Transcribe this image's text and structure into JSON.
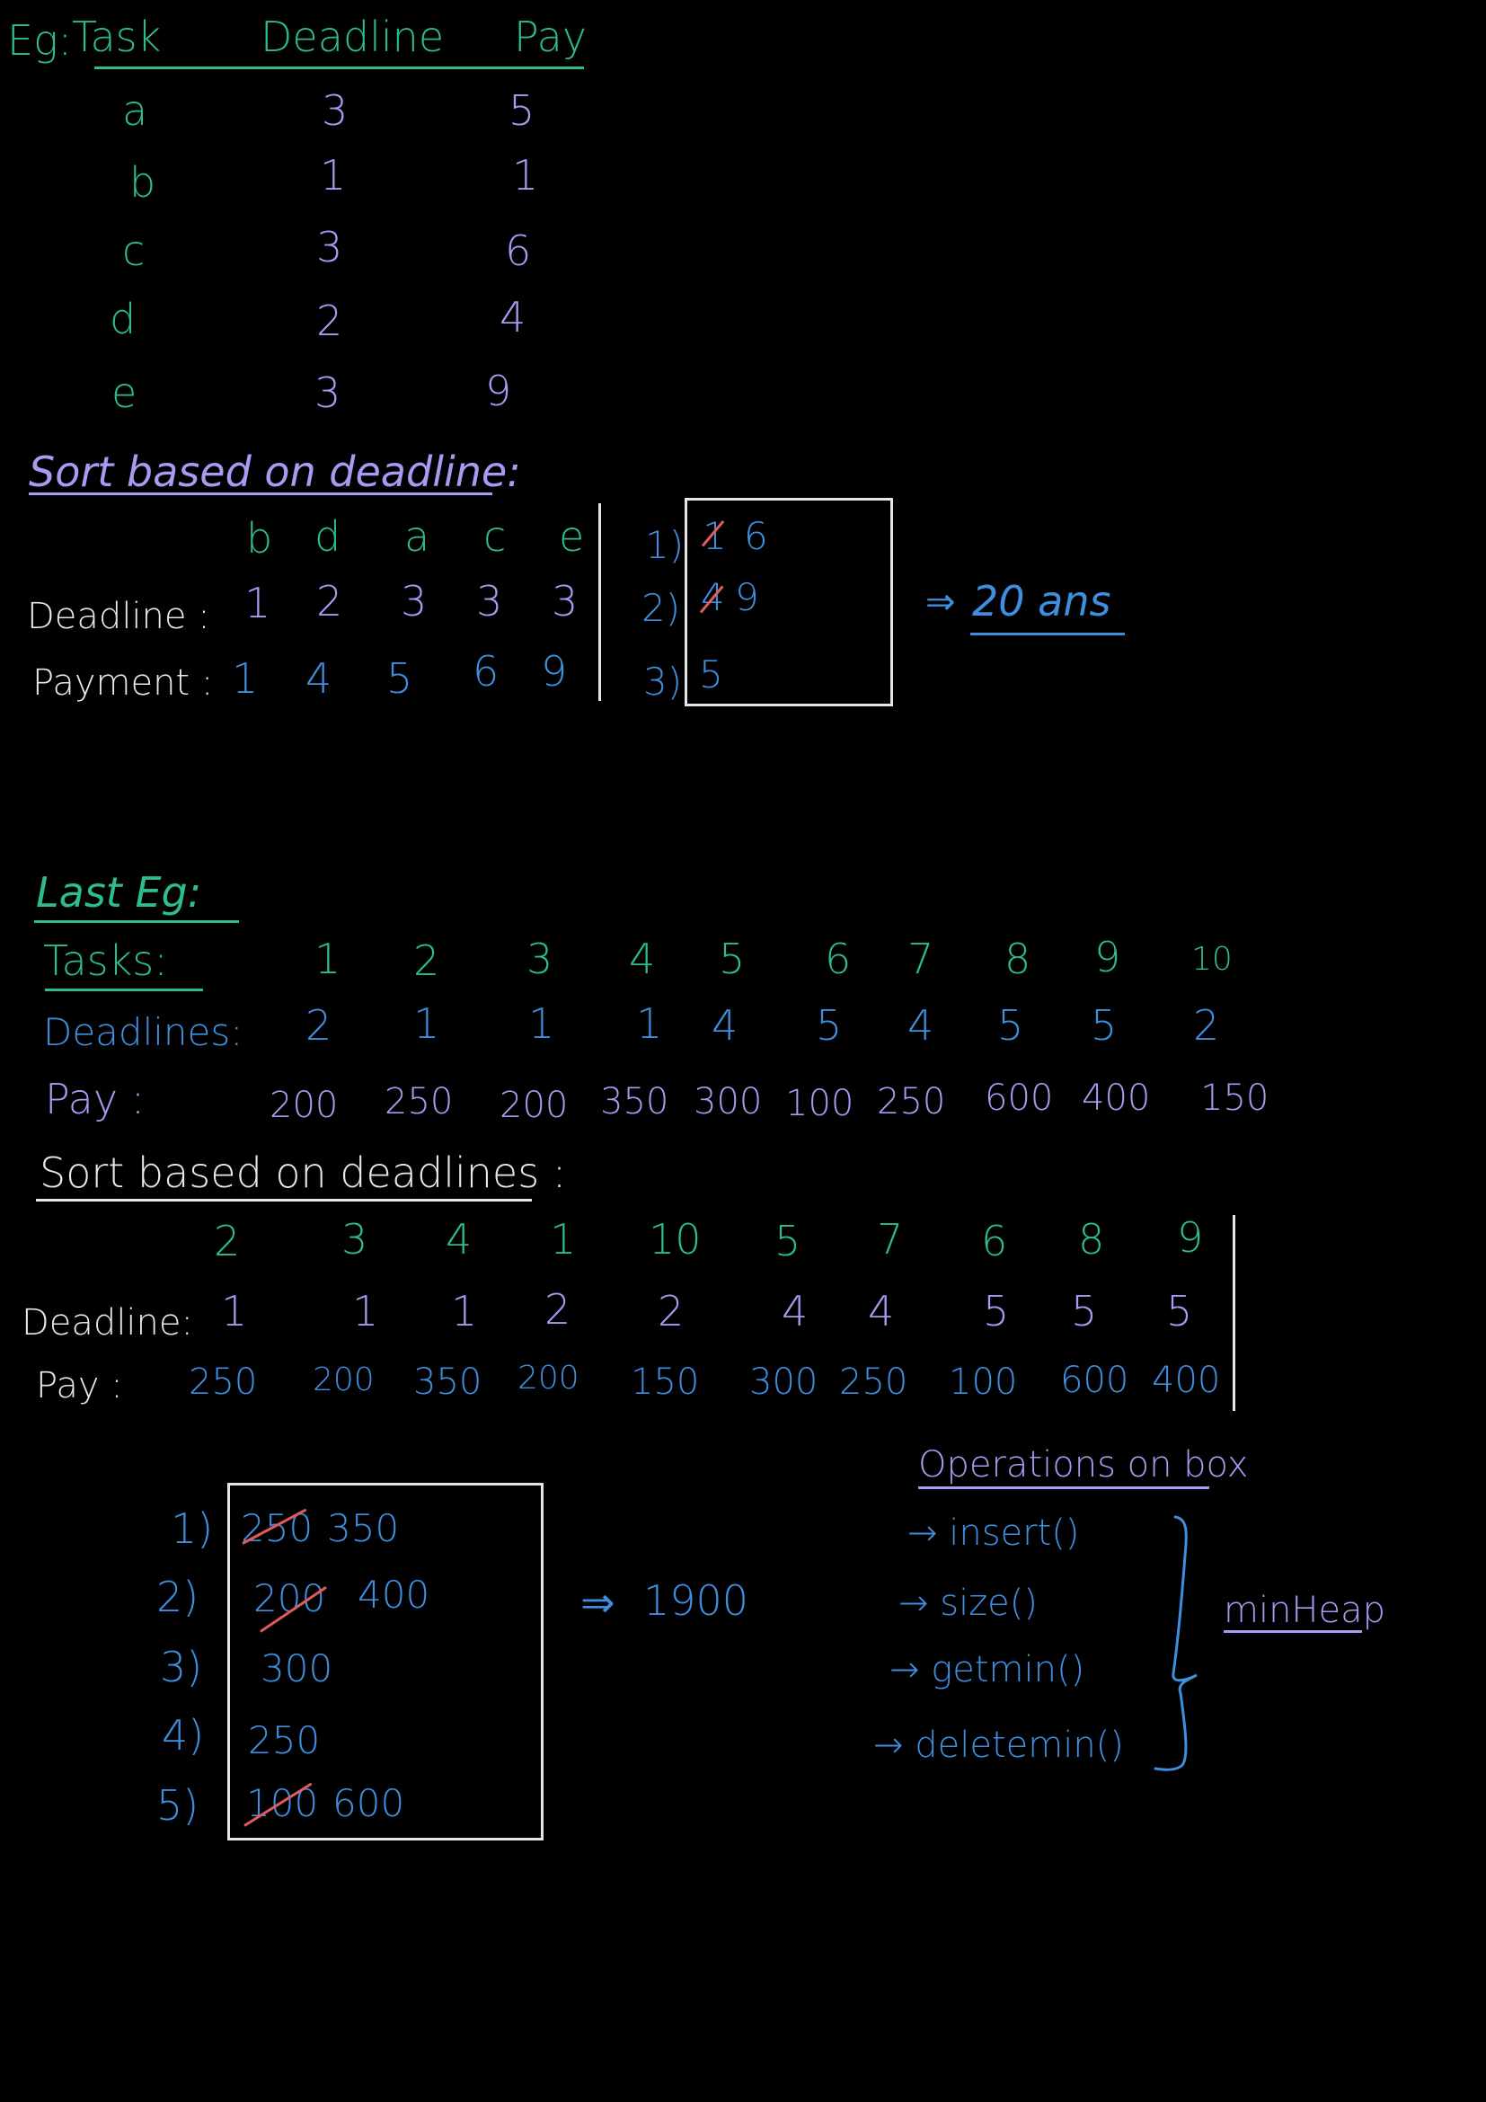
{
  "example1": {
    "label": "Eg:",
    "headers": [
      "Task",
      "Deadline",
      "Pay"
    ],
    "rows": [
      {
        "task": "a",
        "deadline": "3",
        "pay": "5"
      },
      {
        "task": "b",
        "deadline": "1",
        "pay": "1"
      },
      {
        "task": "c",
        "deadline": "3",
        "pay": "6"
      },
      {
        "task": "d",
        "deadline": "2",
        "pay": "4"
      },
      {
        "task": "e",
        "deadline": "3",
        "pay": "9"
      }
    ],
    "sort_heading": "Sort based on deadline:",
    "sorted_tasks": [
      "b",
      "d",
      "a",
      "c",
      "e"
    ],
    "deadline_label": "Deadline :",
    "sorted_deadlines": [
      "1",
      "2",
      "3",
      "3",
      "3"
    ],
    "payment_label": "Payment :",
    "sorted_payments": [
      "1",
      "4",
      "5",
      "6",
      "9"
    ],
    "slot_labels": [
      "1)",
      "2)",
      "3)"
    ],
    "slots": [
      {
        "struck": "1",
        "value": "6"
      },
      {
        "struck": "4",
        "value": "9"
      },
      {
        "struck": "",
        "value": "5"
      }
    ],
    "result_arrow": "⇒",
    "result": "20 ans"
  },
  "example2": {
    "heading": "Last Eg:",
    "tasks_label": "Tasks:",
    "tasks": [
      "1",
      "2",
      "3",
      "4",
      "5",
      "6",
      "7",
      "8",
      "9",
      "10"
    ],
    "deadlines_label": "Deadlines:",
    "deadlines": [
      "2",
      "1",
      "1",
      "1",
      "4",
      "5",
      "4",
      "5",
      "5",
      "2"
    ],
    "pay_label": "Pay :",
    "pays": [
      "200",
      "250",
      "200",
      "350",
      "300",
      "100",
      "250",
      "600",
      "400",
      "150"
    ],
    "sort_heading": "Sort based on deadlines :",
    "sorted_tasks": [
      "2",
      "3",
      "4",
      "1",
      "10",
      "5",
      "7",
      "6",
      "8",
      "9"
    ],
    "sorted_deadline_label": "Deadline:",
    "sorted_deadlines": [
      "1",
      "1",
      "1",
      "2",
      "2",
      "4",
      "4",
      "5",
      "5",
      "5"
    ],
    "sorted_pay_label": "Pay :",
    "sorted_pays": [
      "250",
      "200",
      "350",
      "200",
      "150",
      "300",
      "250",
      "100",
      "600",
      "400"
    ],
    "slot_labels": [
      "1)",
      "2)",
      "3)",
      "4)",
      "5)"
    ],
    "slots": [
      {
        "struck": "250",
        "value": "350"
      },
      {
        "struck": "200",
        "value": "400"
      },
      {
        "struck": "",
        "value": "300"
      },
      {
        "struck": "",
        "value": "250"
      },
      {
        "struck": "100",
        "value": "600"
      }
    ],
    "result_arrow": "⇒",
    "result": "1900",
    "operations_heading": "Operations on box",
    "operations": [
      "→ insert()",
      "→ size()",
      "→ getmin()",
      "→ deletemin()"
    ],
    "structure": "minHeap"
  },
  "colors": {
    "background": "#000000",
    "green": "#2ebc8c",
    "lavender": "#a99bf2",
    "blue": "#3f8fe0",
    "white": "#e8e8e8",
    "strike": "#e25b5b"
  }
}
